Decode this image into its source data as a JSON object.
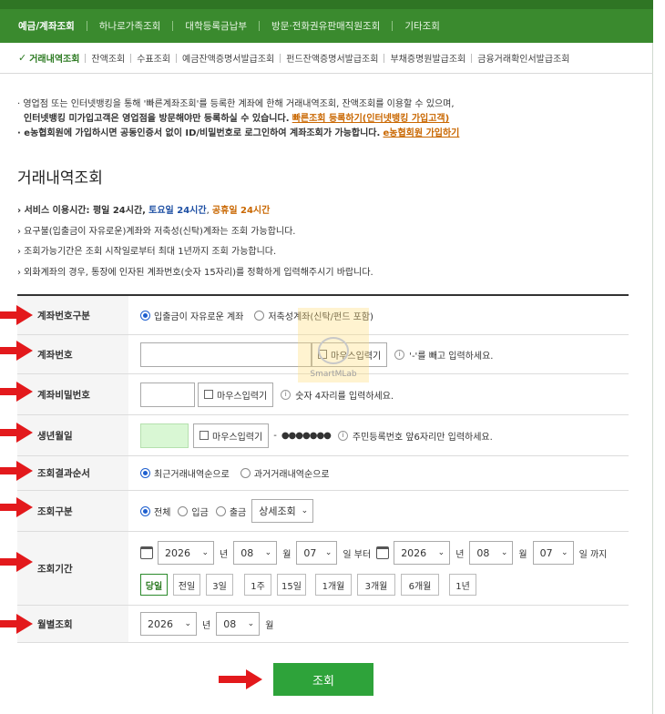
{
  "topnav": {
    "items": [
      "예금/계좌조회",
      "하나로가족조회",
      "대학등록금납부",
      "방문·전화권유판매직원조회",
      "기타조회"
    ]
  },
  "subnav": {
    "items": [
      "거래내역조회",
      "잔액조회",
      "수표조회",
      "예금잔액증명서발급조회",
      "펀드잔액증명서발급조회",
      "부채증명원발급조회",
      "금융거래확인서발급조회"
    ]
  },
  "notice": {
    "line1": "· 영업점 또는 인터넷뱅킹을 통해 '빠른계좌조회'를 등록한 계좌에 한해 거래내역조회, 잔액조회를 이용할 수 있으며,",
    "line2": "인터넷뱅킹 미가입고객은 영업점을 방문해야만 등록하실 수 있습니다.",
    "link1": "빠른조회 등록하기(인터넷뱅킹 가입고객)",
    "line3": "· e농협회원에 가입하시면 공동인증서 없이 ID/비밀번호로 로그인하여 계좌조회가 가능합니다.",
    "link2": "e농협회원 가입하기"
  },
  "page_title": "거래내역조회",
  "info": {
    "service_prefix": "› 서비스 이용시간: 평일 24시간,",
    "saturday": "토요일 24시간",
    "holiday": "공휴일 24시간",
    "line2": "› 요구불(입출금이 자유로운)계좌와 저축성(신탁)계좌는 조회 가능합니다.",
    "line3": "› 조회가능기간은 조회 시작일로부터 최대 1년까지 조회 가능합니다.",
    "line4": "› 외화계좌의 경우, 통장에 인자된 계좌번호(숫자 15자리)를 정확하게 입력해주시기 바랍니다."
  },
  "form": {
    "account_type": {
      "label": "계좌번호구분",
      "opt1": "입출금이 자유로운 계좌",
      "opt2": "저축성계좌(신탁/펀드 포함)"
    },
    "account_no": {
      "label": "계좌번호",
      "mouse": "마우스입력기",
      "hint": "'-'를 빼고 입력하세요."
    },
    "password": {
      "label": "계좌비밀번호",
      "mouse": "마우스입력기",
      "hint": "숫자 4자리를 입력하세요."
    },
    "birth": {
      "label": "생년월일",
      "mouse": "마우스입력기",
      "dash": "-",
      "masked": "●●●●●●●",
      "hint": "주민등록번호 앞6자리만 입력하세요."
    },
    "order": {
      "label": "조회결과순서",
      "opt1": "최근거래내역순으로",
      "opt2": "과거거래내역순으로"
    },
    "category": {
      "label": "조회구분",
      "opt1": "전체",
      "opt2": "입금",
      "opt3": "출금",
      "detail": "상세조회"
    },
    "period": {
      "label": "조회기간",
      "start_year": "2026",
      "start_month": "08",
      "start_day": "07",
      "end_year": "2026",
      "end_month": "08",
      "end_day": "07",
      "unit_year": "년",
      "unit_month": "월",
      "unit_from": "일 부터",
      "unit_to": "일 까지",
      "presets": [
        "당일",
        "전일",
        "3일",
        "1주",
        "15일",
        "1개월",
        "3개월",
        "6개월",
        "1년"
      ]
    },
    "monthly": {
      "label": "월별조회",
      "year": "2026",
      "month": "08",
      "unit_year": "년",
      "unit_month": "월"
    }
  },
  "submit_label": "조회",
  "watermark": "SmartMLab",
  "colors": {
    "nav_green": "#3a8a2e",
    "submit_green": "#2ea33a",
    "radio_blue": "#1e5fcf",
    "link_orange": "#c96700",
    "arrow_red": "#e3191c"
  }
}
